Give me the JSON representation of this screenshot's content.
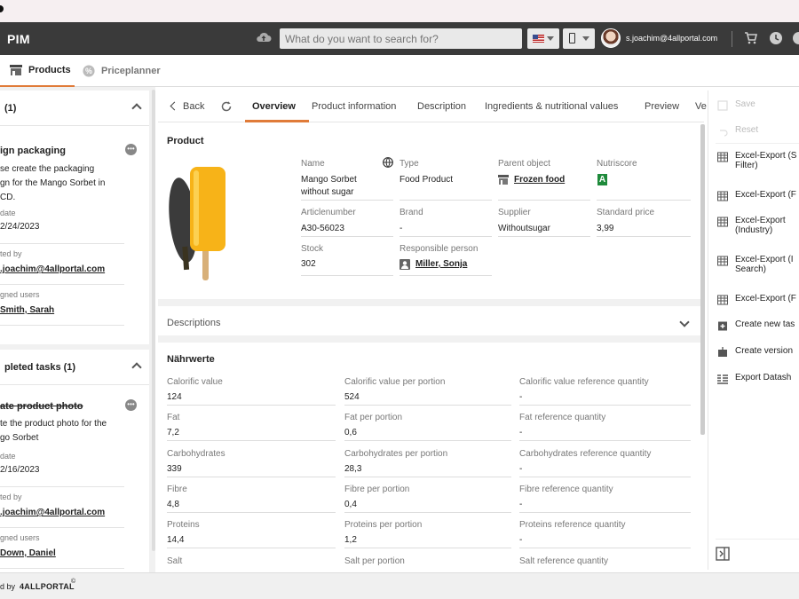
{
  "header": {
    "app_title": "PIM",
    "search_placeholder": "What do you want to search for?",
    "user_name": "s.joachim@4allportal.com",
    "icons": [
      "cloud-upload-icon",
      "flag-us-icon",
      "phone-icon",
      "cart-icon",
      "clock-icon"
    ]
  },
  "nav_tabs": [
    {
      "label": "Products",
      "active": true
    },
    {
      "label": "Priceplanner",
      "active": false
    }
  ],
  "left": {
    "open_tasks_header": "(1)",
    "task1": {
      "title": "ign packaging",
      "desc": [
        "se create the packaging",
        "gn for the Mango Sorbet in",
        "CD."
      ],
      "date_label": "date",
      "date": "2/24/2023",
      "created_label": "ted by",
      "created_by": ".joachim@4allportal.com",
      "assigned_label": "gned users",
      "assigned": "Smith, Sarah"
    },
    "completed_header": "pleted tasks (1)",
    "task2": {
      "title": "ate product photo",
      "desc": [
        "te the product photo for the",
        "go Sorbet"
      ],
      "date_label": "date",
      "date": "2/16/2023",
      "created_label": "ted by",
      "created_by": ".joachim@4allportal.com",
      "assigned_label": "gned users",
      "assigned": "Down, Daniel"
    }
  },
  "subtabs": {
    "back": "Back",
    "items": [
      "Overview",
      "Product information",
      "Description",
      "Ingredients & nutritional values",
      "Preview",
      "Ve"
    ]
  },
  "product": {
    "section_title": "Product",
    "fields": {
      "name_label": "Name",
      "name_value_1": "Mango Sorbet",
      "name_value_2": "without sugar",
      "type_label": "Type",
      "type_value": "Food Product",
      "parent_label": "Parent object",
      "parent_value": "Frozen food",
      "nutri_label": "Nutriscore",
      "nutri_value": "A",
      "article_label": "Articlenumber",
      "article_value": "A30-56023",
      "brand_label": "Brand",
      "brand_value": "-",
      "supplier_label": "Supplier",
      "supplier_value": "Withoutsugar",
      "price_label": "Standard price",
      "price_value": "3,99",
      "stock_label": "Stock",
      "stock_value": "302",
      "resp_label": "Responsible person",
      "resp_value": "Miller, Sonja"
    }
  },
  "descriptions_title": "Descriptions",
  "nutrition": {
    "title": "Nährwerte",
    "rows": [
      [
        {
          "l": "Calorific value",
          "v": "124"
        },
        {
          "l": "Calorific value per portion",
          "v": "524"
        },
        {
          "l": "Calorific value reference quantity",
          "v": "-"
        }
      ],
      [
        {
          "l": "Fat",
          "v": "7,2"
        },
        {
          "l": "Fat per portion",
          "v": "0,6"
        },
        {
          "l": "Fat reference quantity",
          "v": "-"
        }
      ],
      [
        {
          "l": "Carbohydrates",
          "v": "339"
        },
        {
          "l": "Carbohydrates per portion",
          "v": "28,3"
        },
        {
          "l": "Carbohydrates reference quantity",
          "v": "-"
        }
      ],
      [
        {
          "l": "Fibre",
          "v": "4,8"
        },
        {
          "l": "Fibre per portion",
          "v": "0,4"
        },
        {
          "l": "Fibre reference quantity",
          "v": "-"
        }
      ],
      [
        {
          "l": "Proteins",
          "v": "14,4"
        },
        {
          "l": "Proteins per portion",
          "v": "1,2"
        },
        {
          "l": "Proteins reference quantity",
          "v": "-"
        }
      ],
      [
        {
          "l": "Salt",
          "v": ""
        },
        {
          "l": "Salt per portion",
          "v": ""
        },
        {
          "l": "Salt reference quantity",
          "v": ""
        }
      ]
    ]
  },
  "actions": {
    "save": "Save",
    "reset": "Reset",
    "excel1_a": "Excel-Export (S",
    "excel1_b": "Filter)",
    "excel2": "Excel-Export (F",
    "excel3_a": "Excel-Export",
    "excel3_b": "(Industry)",
    "excel4_a": "Excel-Export (I",
    "excel4_b": "Search)",
    "excel5": "Excel-Export (F",
    "create_task": "Create new tas",
    "create_version": "Create version",
    "export_datasheet": "Export Datash"
  },
  "footer": {
    "prefix": "d by",
    "brand": "4ALLPORTAL",
    "mark": "©"
  },
  "colors": {
    "accent": "#e07b39",
    "header_bg": "#3a3a3a",
    "nutri_green": "#1e8a3b"
  }
}
